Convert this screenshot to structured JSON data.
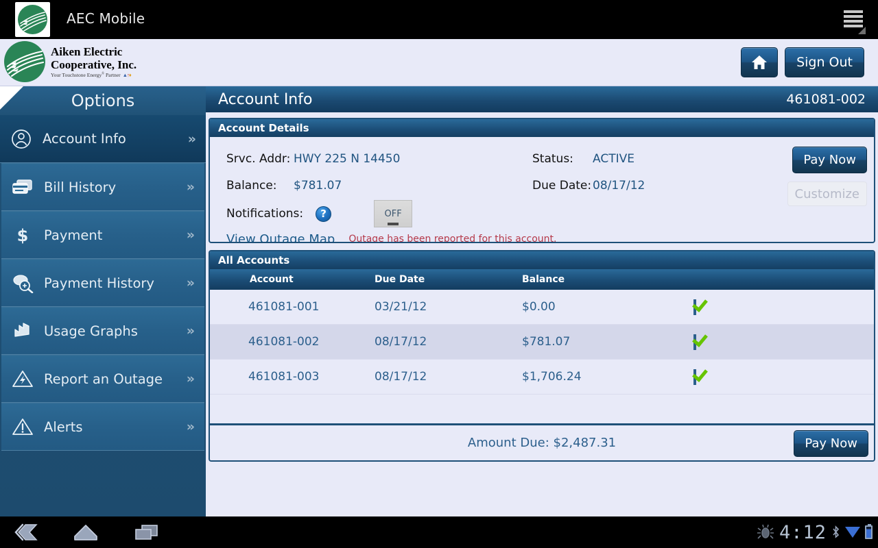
{
  "android": {
    "app_title": "AEC Mobile",
    "menu_icon": "hamburger-icon",
    "nav": {
      "back": "back-icon",
      "home": "home-icon",
      "recents": "recents-icon"
    },
    "status": {
      "debug_icon": "bug-icon",
      "time": "4:12",
      "bluetooth_icon": "bluetooth-icon",
      "signal_icon": "wifi-icon",
      "battery_icon": "battery-icon"
    }
  },
  "header": {
    "brand_line1": "Aiken Electric",
    "brand_line2": "Cooperative, Inc.",
    "brand_tagline": "Your Touchstone Energy",
    "brand_tagline_suffix": " Partner",
    "home_icon": "home-icon",
    "sign_out_label": "Sign Out"
  },
  "sidebar": {
    "title": "Options",
    "items": [
      {
        "label": "Account Info",
        "icon": "user-circle-icon",
        "active": true
      },
      {
        "label": "Bill History",
        "icon": "credit-cards-icon",
        "active": false
      },
      {
        "label": "Payment",
        "icon": "dollar-sign-icon",
        "active": false
      },
      {
        "label": "Payment History",
        "icon": "money-search-icon",
        "active": false
      },
      {
        "label": "Usage Graphs",
        "icon": "bar-chart-icon",
        "active": false
      },
      {
        "label": "Report an Outage",
        "icon": "lightning-warning-icon",
        "active": false
      },
      {
        "label": "Alerts",
        "icon": "exclamation-warning-icon",
        "active": false
      }
    ],
    "chevron": "chevron-right-icon"
  },
  "content": {
    "title": "Account Info",
    "account_number": "461081-002",
    "watermark": {
      "line1": "Aiken Electric",
      "line2": "Cooperative, Inc.",
      "tagline": "Your Touchstone Energy Partner"
    },
    "details": {
      "panel_title": "Account Details",
      "svc_addr_label": "Srvc. Addr:",
      "svc_addr_value": "HWY 225 N 14450",
      "balance_label": "Balance:",
      "balance_value": "$781.07",
      "status_label": "Status:",
      "status_value": "ACTIVE",
      "due_date_label": "Due Date:",
      "due_date_value": "08/17/12",
      "notifications_label": "Notifications:",
      "help_icon": "help-question-icon",
      "toggle_value": "OFF",
      "outage_map_link": "View Outage Map",
      "outage_message": "Outage has been reported for this account.",
      "pay_now_label": "Pay Now",
      "customize_label": "Customize"
    },
    "accounts": {
      "panel_title": "All Accounts",
      "columns": [
        "Account",
        "Due Date",
        "Balance",
        ""
      ],
      "rows": [
        {
          "account": "461081-001",
          "due_date": "03/21/12",
          "balance": "$0.00",
          "checked": true
        },
        {
          "account": "461081-002",
          "due_date": "08/17/12",
          "balance": "$781.07",
          "checked": true
        },
        {
          "account": "461081-003",
          "due_date": "08/17/12",
          "balance": "$1,706.24",
          "checked": true
        }
      ],
      "amount_due_label": "Amount Due:",
      "amount_due_value": "$2,487.31",
      "pay_now_label": "Pay Now"
    }
  },
  "colors": {
    "panel_border": "#1e5078",
    "header_blue": "#1b4a72",
    "sidebar_blue": "#27608a",
    "sidebar_active": "#10395a",
    "content_bg": "#e8eaf8",
    "link_blue": "#1d5b8a",
    "alert_red": "#b5394a",
    "check_green": "#66c400",
    "brand_green": "#2a8556"
  }
}
